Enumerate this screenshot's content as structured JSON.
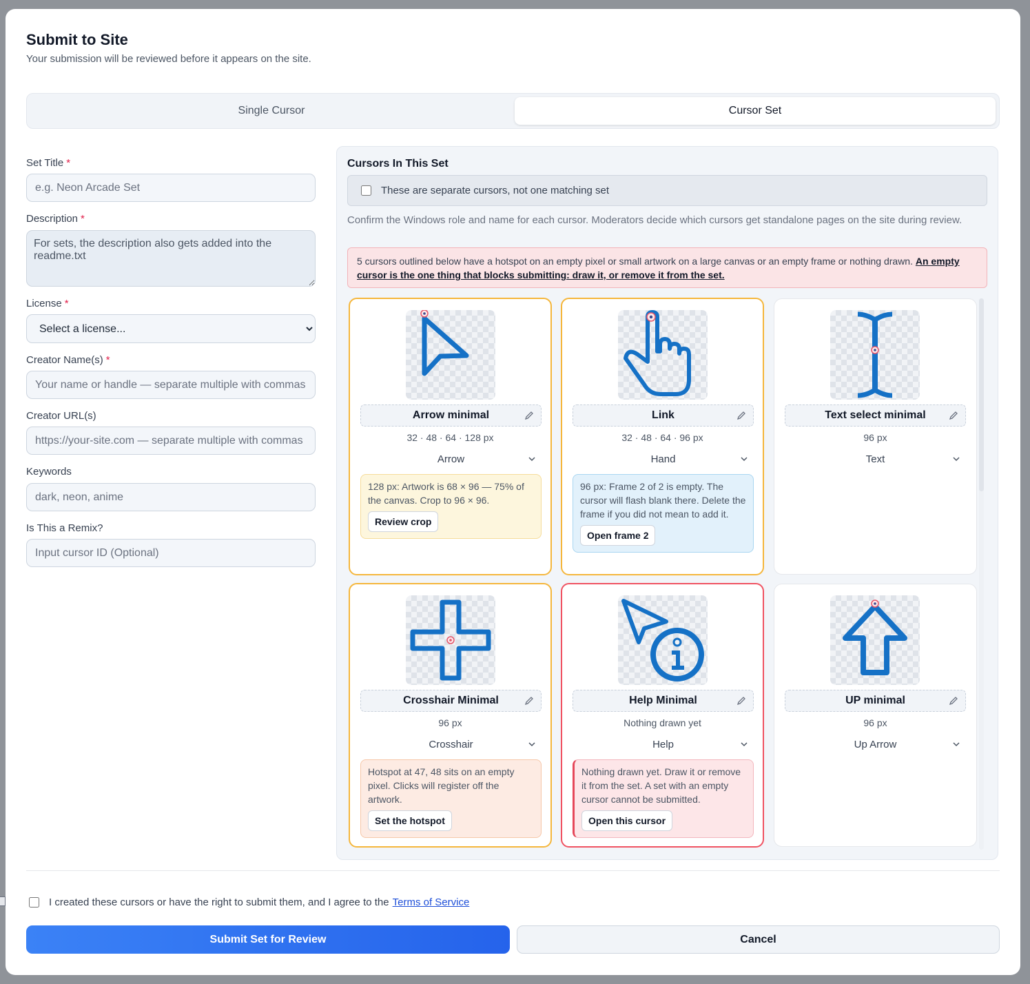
{
  "modal": {
    "title": "Submit to Site",
    "subtitle": "Your submission will be reviewed before it appears on the site."
  },
  "tabs": [
    {
      "label": "Single Cursor",
      "active": false
    },
    {
      "label": "Cursor Set",
      "active": true
    }
  ],
  "form": {
    "set_title": {
      "label": "Set Title",
      "required": "*",
      "placeholder": "e.g. Neon Arcade Set",
      "value": ""
    },
    "description": {
      "label": "Description",
      "required": "*",
      "placeholder": "For sets, the description also gets added into the readme.txt",
      "value": ""
    },
    "license": {
      "label": "License",
      "required": "*",
      "selected": "Select a license..."
    },
    "creator_names": {
      "label": "Creator Name(s)",
      "required": "*",
      "placeholder": "Your name or handle — separate multiple with commas",
      "value": ""
    },
    "creator_urls": {
      "label": "Creator URL(s)",
      "placeholder": "https://your-site.com — separate multiple with commas",
      "value": ""
    },
    "keywords": {
      "label": "Keywords",
      "placeholder": "dark, neon, anime",
      "value": ""
    },
    "remix": {
      "label": "Is This a Remix?",
      "placeholder": "Input cursor ID (Optional)",
      "value": ""
    }
  },
  "cursors_panel": {
    "title": "Cursors In This Set",
    "separate_checkbox": {
      "label": "These are separate cursors, not one matching set",
      "checked": false
    },
    "help": "Confirm the Windows role and name for each cursor. Moderators decide which cursors get standalone pages on the site during review.",
    "alert": {
      "text": "5 cursors outlined below have a hotspot on an empty pixel or small artwork on a large canvas or an empty frame or nothing drawn.",
      "strong": "An empty cursor is the one thing that blocks submitting: draw it, or remove it from the set."
    },
    "cursors": [
      {
        "name": "Arrow minimal",
        "sizes": "32 · 48 · 64 · 128 px",
        "role": "Arrow",
        "icon": "arrow-cursor-icon",
        "status": "warn",
        "notice": {
          "tone": "yellow",
          "text": "128 px: Artwork is 68 × 96 — 75% of the canvas. Crop to 96 × 96.",
          "button": "Review crop"
        }
      },
      {
        "name": "Link",
        "sizes": "32 · 48 · 64 · 96 px",
        "role": "Hand",
        "icon": "hand-cursor-icon",
        "status": "warn",
        "notice": {
          "tone": "blue",
          "text": "96 px: Frame 2 of 2 is empty. The cursor will flash blank there. Delete the frame if you did not mean to add it.",
          "button": "Open frame 2"
        }
      },
      {
        "name": "Text select minimal",
        "sizes": "96 px",
        "role": "Text",
        "icon": "text-select-cursor-icon",
        "status": "ok",
        "notice": null
      },
      {
        "name": "Crosshair Minimal",
        "sizes": "96 px",
        "role": "Crosshair",
        "icon": "crosshair-cursor-icon",
        "status": "warn",
        "notice": {
          "tone": "orange",
          "text": "Hotspot at 47, 48 sits on an empty pixel. Clicks will register off the artwork.",
          "button": "Set the hotspot"
        }
      },
      {
        "name": "Help Minimal",
        "sizes": "Nothing drawn yet",
        "role": "Help",
        "icon": "help-cursor-icon",
        "status": "err",
        "notice": {
          "tone": "red",
          "text": "Nothing drawn yet. Draw it or remove it from the set. A set with an empty cursor cannot be submitted.",
          "button": "Open this cursor"
        }
      },
      {
        "name": "UP minimal",
        "sizes": "96 px",
        "role": "Up Arrow",
        "icon": "up-arrow-cursor-icon",
        "status": "ok",
        "notice": null
      }
    ]
  },
  "footer": {
    "agree_text": "I created these cursors or have the right to submit them, and I agree to the",
    "terms_link": "Terms of Service",
    "submit_label": "Submit Set for Review",
    "cancel_label": "Cancel"
  },
  "colors": {
    "accent": "#2563eb",
    "cursor_art": "#1571c6",
    "warn_border": "#f5b63b",
    "error_border": "#f05261"
  }
}
